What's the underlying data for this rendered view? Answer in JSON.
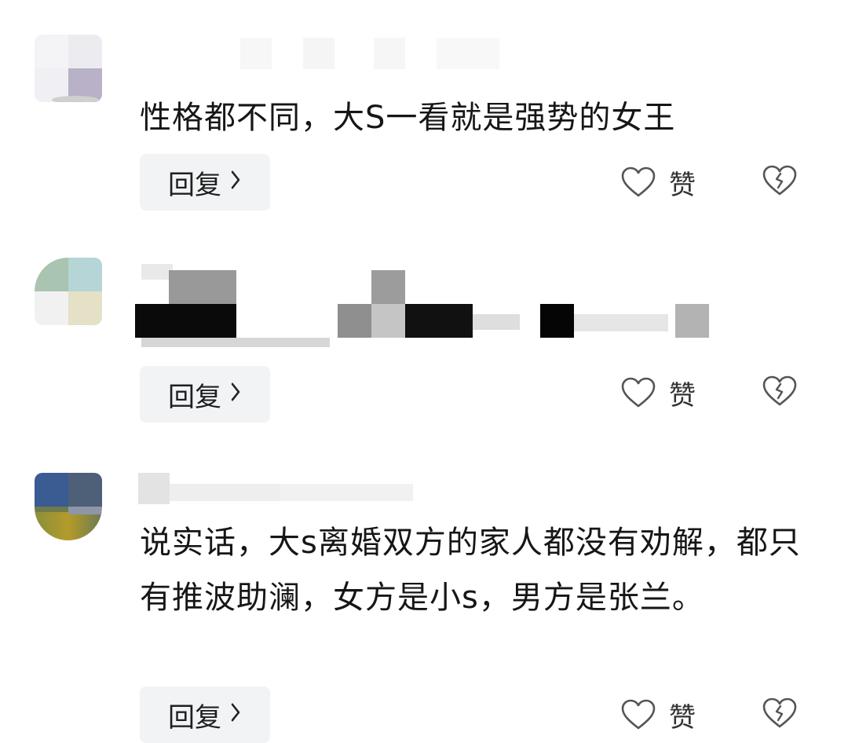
{
  "comments": [
    {
      "text": "性格都不同，大S一看就是强势的女王",
      "reply_label": "回复",
      "like_label": "赞"
    },
    {
      "text": "",
      "reply_label": "回复",
      "like_label": "赞"
    },
    {
      "text": "说实话，大s离婚双方的家人都没有劝解，都只有推波助澜，女方是小s，男方是张兰。",
      "reply_label": "回复",
      "like_label": "赞"
    }
  ],
  "icons": {
    "like": "heart-outline-icon",
    "dislike": "broken-heart-icon",
    "reply_chevron": "chevron-right-icon"
  },
  "colors": {
    "reply_bg": "#f2f3f5",
    "icon_stroke": "#555555"
  }
}
